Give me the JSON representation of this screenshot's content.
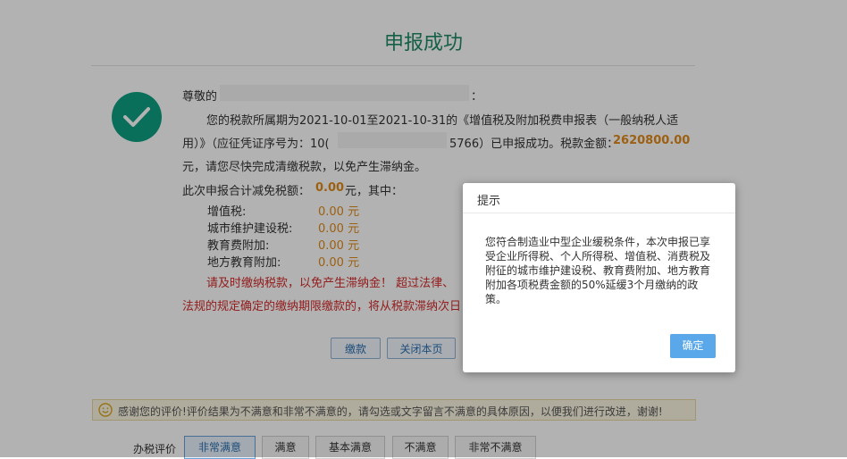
{
  "page": {
    "title": "申报成功",
    "greeting_prefix": "尊敬的",
    "greeting_suffix": "：",
    "line1": "您的税款所属期为2021-10-01至2021-10-31的《增值税及附加税费申报表（一般纳税人适",
    "line2_prefix": "用）》（应征凭证序号为：10(",
    "line2_mid": "5766）已申报成功。税款金额：",
    "tax_amount": "2620800.00",
    "line3": "元，请您尽快完成清缴税款，以免产生滞纳金。",
    "reduction_prefix": "此次申报合计减免税额：",
    "reduction_amount": "0.00",
    "reduction_suffix": "元，其中：",
    "reductions": [
      {
        "label": "增值税:",
        "value": "0.00 元"
      },
      {
        "label": "城市维护建设税:",
        "value": "0.00 元"
      },
      {
        "label": "教育费附加:",
        "value": "0.00 元"
      },
      {
        "label": "地方教育附加:",
        "value": "0.00 元"
      }
    ],
    "warning_line1": "请及时缴纳税款，以免产生滞纳金！ 超过法律、",
    "warning_line2": "法规的规定确定的缴纳期限缴款的，将从税款滞纳次日",
    "buttons": {
      "pay": "缴款",
      "close": "关闭本页"
    }
  },
  "evaluation": {
    "notice": "感谢您的评价!评价结果为不满意和非常不满意的，请勾选或文字留言不满意的具体原因，以便我们进行改进，谢谢!",
    "label": "办税评价",
    "options": [
      "非常满意",
      "满意",
      "基本满意",
      "不满意",
      "非常不满意"
    ],
    "selected": "非常满意"
  },
  "dialog": {
    "title": "提示",
    "message": "您符合制造业中型企业缓税条件，本次申报已享受企业所得税、个人所得税、增值税、消费税及附征的城市维护建设税、教育费附加、地方教育附加各项税费金额的50%延缓3个月缴纳的政策。",
    "ok_label": "确定"
  },
  "colors": {
    "title_green": "#1f8a66",
    "check_green": "#0f9f82",
    "amount_orange": "#e08a1a",
    "warning_red": "#d42a2a",
    "ok_blue": "#5aa7ea"
  },
  "icons": {
    "success": "check-circle-icon",
    "smile": "smile-icon"
  }
}
